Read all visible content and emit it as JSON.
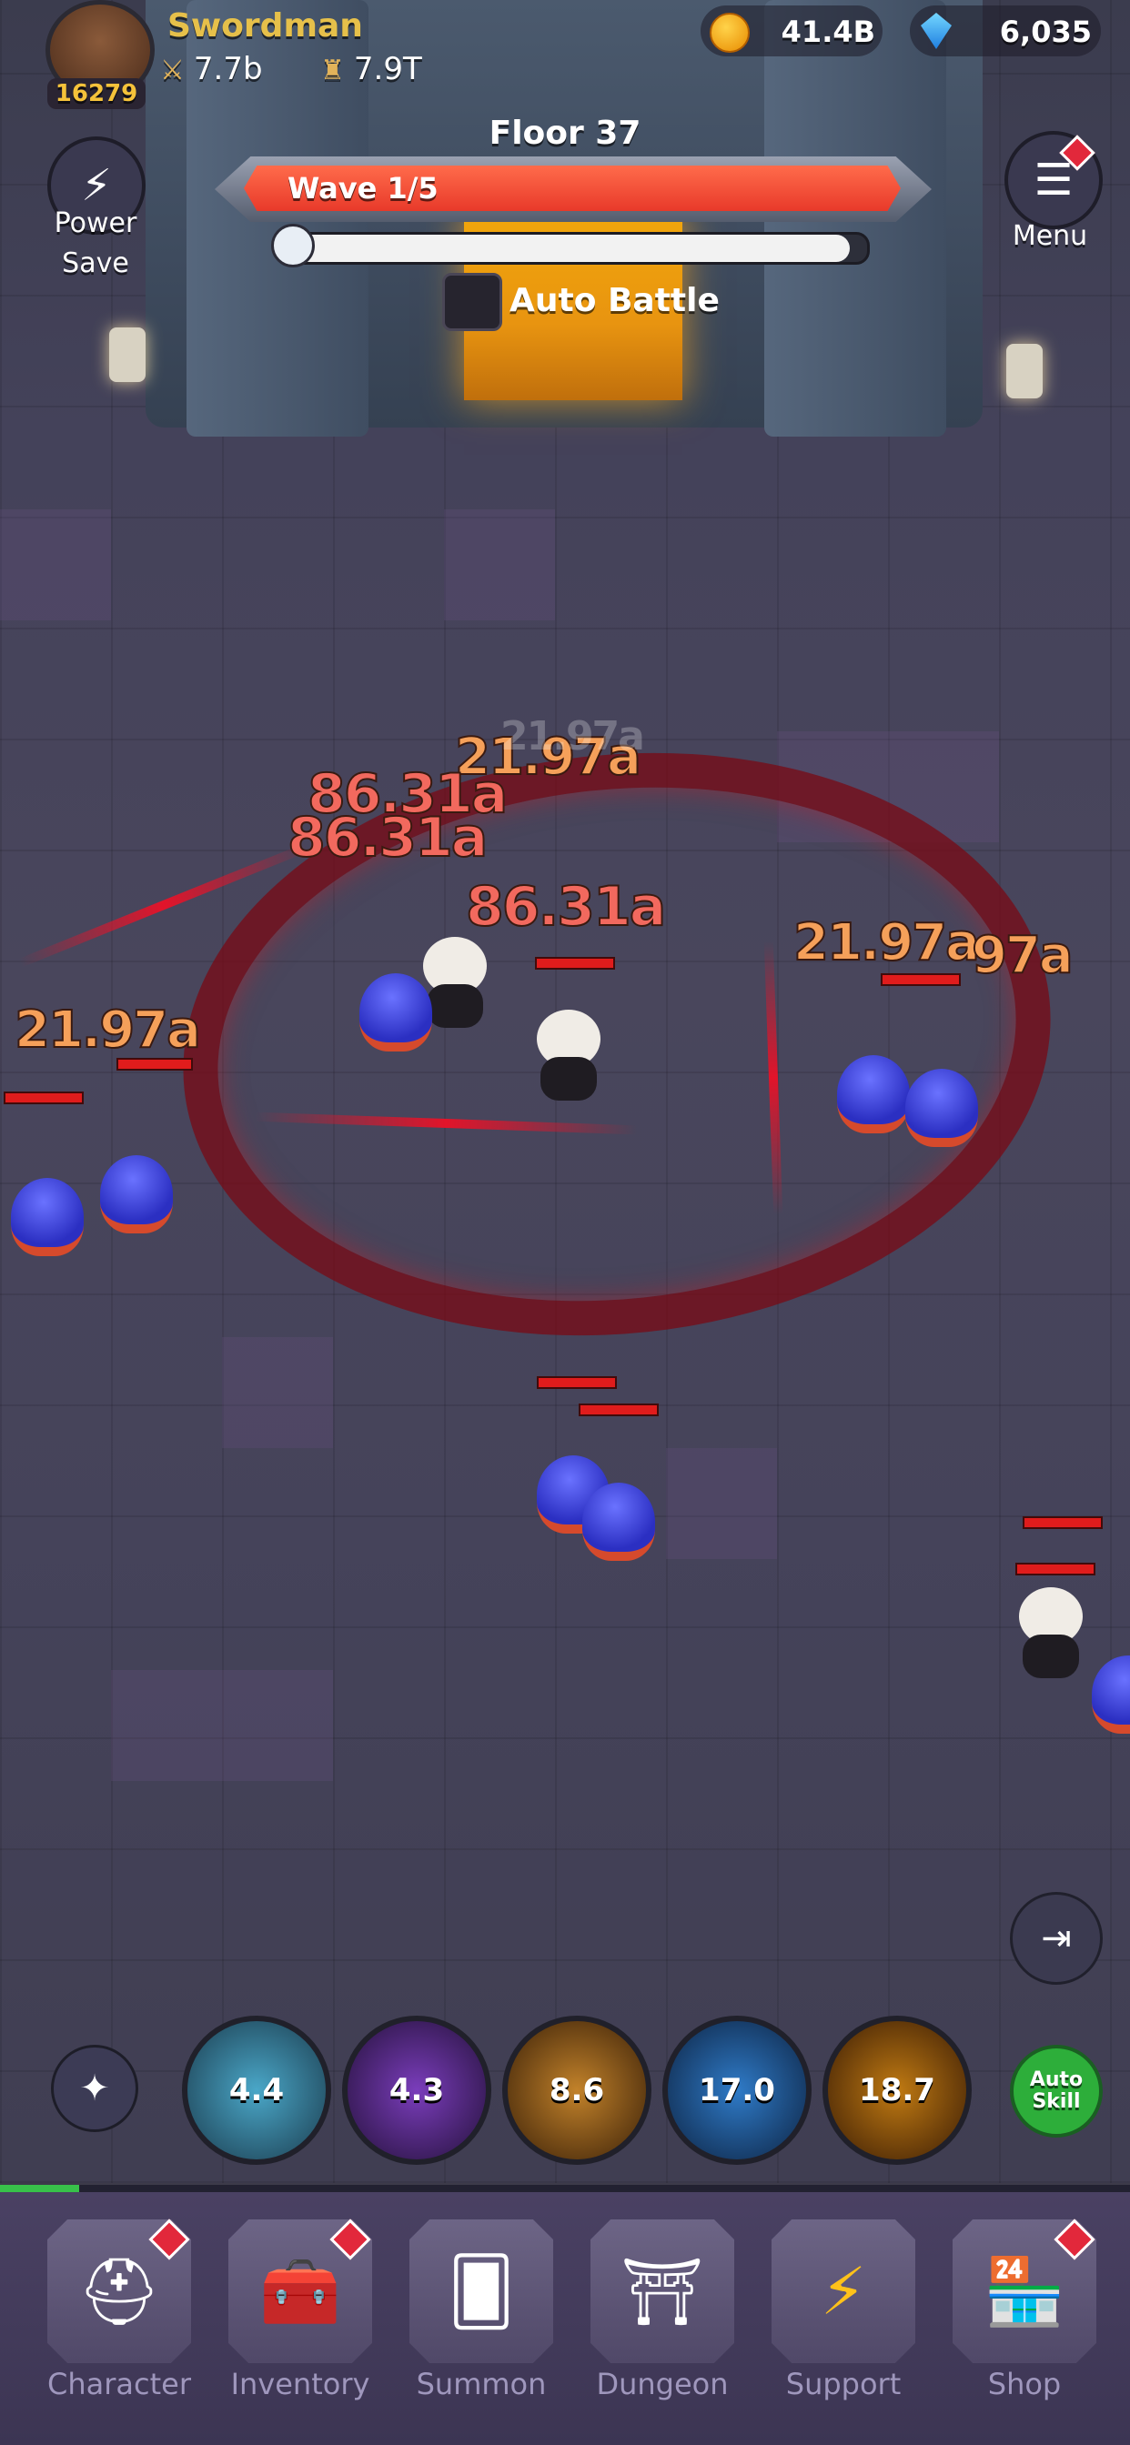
{
  "player": {
    "name": "Swordman",
    "level": "16279",
    "attack": "7.7b",
    "defense": "7.9T"
  },
  "currency": {
    "gold": "41.4B",
    "gems": "6,035"
  },
  "side_buttons": {
    "power_save": "Power\nSave",
    "menu": "Menu"
  },
  "battle": {
    "floor": "Floor 37",
    "wave": "Wave 1/5",
    "wave_progress": 1.0,
    "timer_progress": 0.97,
    "auto_battle": "Auto Battle"
  },
  "damage_numbers": [
    "21.97a",
    "86.31a",
    "86.31a",
    "86.31a",
    "21.97a",
    "21.97a",
    "21.97a",
    "97a"
  ],
  "skills": [
    {
      "cooldown": "4.4"
    },
    {
      "cooldown": "4.3"
    },
    {
      "cooldown": "8.6"
    },
    {
      "cooldown": "17.0"
    },
    {
      "cooldown": "18.7"
    }
  ],
  "auto_skill": "Auto\nSkill",
  "stage_progress": 0.07,
  "nav": [
    {
      "label": "Character",
      "icon": "helmet-icon",
      "badge": true
    },
    {
      "label": "Inventory",
      "icon": "chest-icon",
      "badge": true
    },
    {
      "label": "Summon",
      "icon": "summon-card-icon",
      "badge": false
    },
    {
      "label": "Dungeon",
      "icon": "dungeon-door-icon",
      "badge": false
    },
    {
      "label": "Support",
      "icon": "lightning-icon",
      "badge": false
    },
    {
      "label": "Shop",
      "icon": "shop-icon",
      "badge": true
    }
  ],
  "colors": {
    "wave_bar": "#e83a2a",
    "gold_text": "#e6c04a",
    "auto_skill": "#2dae3a",
    "nav_bg": "#3c3553"
  }
}
